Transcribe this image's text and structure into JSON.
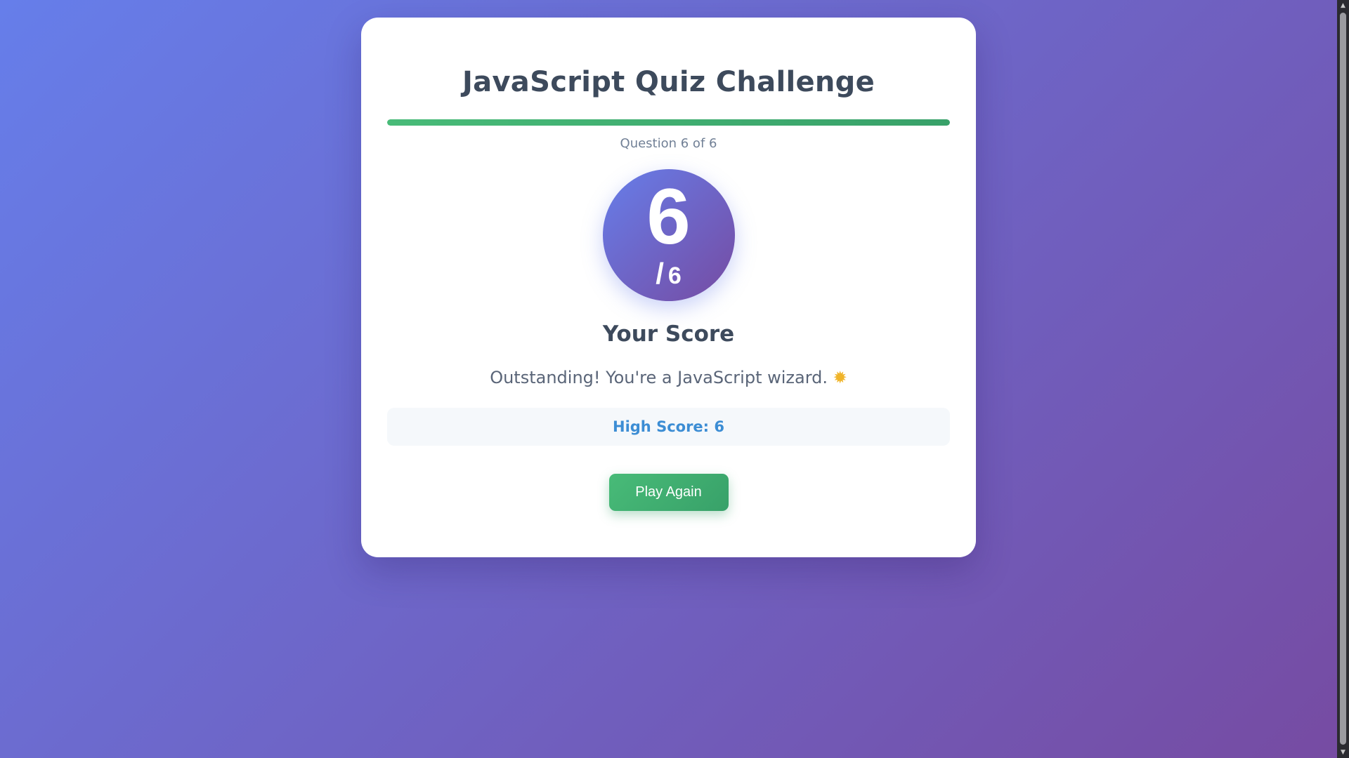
{
  "quiz": {
    "title": "JavaScript Quiz Challenge",
    "progress_fraction": 1.0,
    "question_counter": "Question 6 of 6"
  },
  "result": {
    "score": "6",
    "total_slash": "/",
    "total": "6",
    "score_label": "Your Score",
    "message": "Outstanding! You're a JavaScript wizard.",
    "message_icon": "sun-emoji",
    "high_score": "High Score: 6"
  },
  "actions": {
    "play_again_label": "Play Again"
  },
  "colors": {
    "background_start": "#667eea",
    "background_end": "#764ba2",
    "progress_green": "#48bb78",
    "high_score_blue": "#3c8dd4",
    "title_text": "#3d4a5c"
  }
}
